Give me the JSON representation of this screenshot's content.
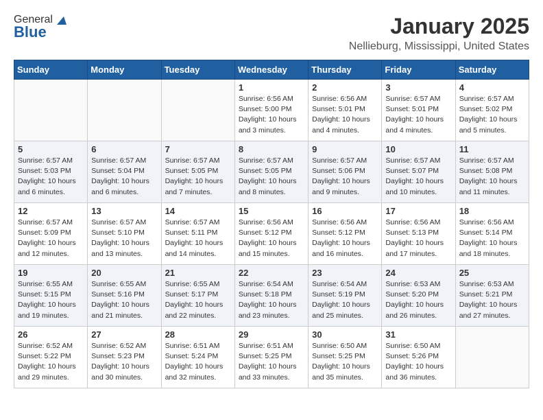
{
  "header": {
    "logo_general": "General",
    "logo_blue": "Blue",
    "title": "January 2025",
    "subtitle": "Nellieburg, Mississippi, United States"
  },
  "weekdays": [
    "Sunday",
    "Monday",
    "Tuesday",
    "Wednesday",
    "Thursday",
    "Friday",
    "Saturday"
  ],
  "weeks": [
    [
      {
        "day": "",
        "sunrise": "",
        "sunset": "",
        "daylight": ""
      },
      {
        "day": "",
        "sunrise": "",
        "sunset": "",
        "daylight": ""
      },
      {
        "day": "",
        "sunrise": "",
        "sunset": "",
        "daylight": ""
      },
      {
        "day": "1",
        "sunrise": "Sunrise: 6:56 AM",
        "sunset": "Sunset: 5:00 PM",
        "daylight": "Daylight: 10 hours and 3 minutes."
      },
      {
        "day": "2",
        "sunrise": "Sunrise: 6:56 AM",
        "sunset": "Sunset: 5:01 PM",
        "daylight": "Daylight: 10 hours and 4 minutes."
      },
      {
        "day": "3",
        "sunrise": "Sunrise: 6:57 AM",
        "sunset": "Sunset: 5:01 PM",
        "daylight": "Daylight: 10 hours and 4 minutes."
      },
      {
        "day": "4",
        "sunrise": "Sunrise: 6:57 AM",
        "sunset": "Sunset: 5:02 PM",
        "daylight": "Daylight: 10 hours and 5 minutes."
      }
    ],
    [
      {
        "day": "5",
        "sunrise": "Sunrise: 6:57 AM",
        "sunset": "Sunset: 5:03 PM",
        "daylight": "Daylight: 10 hours and 6 minutes."
      },
      {
        "day": "6",
        "sunrise": "Sunrise: 6:57 AM",
        "sunset": "Sunset: 5:04 PM",
        "daylight": "Daylight: 10 hours and 6 minutes."
      },
      {
        "day": "7",
        "sunrise": "Sunrise: 6:57 AM",
        "sunset": "Sunset: 5:05 PM",
        "daylight": "Daylight: 10 hours and 7 minutes."
      },
      {
        "day": "8",
        "sunrise": "Sunrise: 6:57 AM",
        "sunset": "Sunset: 5:05 PM",
        "daylight": "Daylight: 10 hours and 8 minutes."
      },
      {
        "day": "9",
        "sunrise": "Sunrise: 6:57 AM",
        "sunset": "Sunset: 5:06 PM",
        "daylight": "Daylight: 10 hours and 9 minutes."
      },
      {
        "day": "10",
        "sunrise": "Sunrise: 6:57 AM",
        "sunset": "Sunset: 5:07 PM",
        "daylight": "Daylight: 10 hours and 10 minutes."
      },
      {
        "day": "11",
        "sunrise": "Sunrise: 6:57 AM",
        "sunset": "Sunset: 5:08 PM",
        "daylight": "Daylight: 10 hours and 11 minutes."
      }
    ],
    [
      {
        "day": "12",
        "sunrise": "Sunrise: 6:57 AM",
        "sunset": "Sunset: 5:09 PM",
        "daylight": "Daylight: 10 hours and 12 minutes."
      },
      {
        "day": "13",
        "sunrise": "Sunrise: 6:57 AM",
        "sunset": "Sunset: 5:10 PM",
        "daylight": "Daylight: 10 hours and 13 minutes."
      },
      {
        "day": "14",
        "sunrise": "Sunrise: 6:57 AM",
        "sunset": "Sunset: 5:11 PM",
        "daylight": "Daylight: 10 hours and 14 minutes."
      },
      {
        "day": "15",
        "sunrise": "Sunrise: 6:56 AM",
        "sunset": "Sunset: 5:12 PM",
        "daylight": "Daylight: 10 hours and 15 minutes."
      },
      {
        "day": "16",
        "sunrise": "Sunrise: 6:56 AM",
        "sunset": "Sunset: 5:12 PM",
        "daylight": "Daylight: 10 hours and 16 minutes."
      },
      {
        "day": "17",
        "sunrise": "Sunrise: 6:56 AM",
        "sunset": "Sunset: 5:13 PM",
        "daylight": "Daylight: 10 hours and 17 minutes."
      },
      {
        "day": "18",
        "sunrise": "Sunrise: 6:56 AM",
        "sunset": "Sunset: 5:14 PM",
        "daylight": "Daylight: 10 hours and 18 minutes."
      }
    ],
    [
      {
        "day": "19",
        "sunrise": "Sunrise: 6:55 AM",
        "sunset": "Sunset: 5:15 PM",
        "daylight": "Daylight: 10 hours and 19 minutes."
      },
      {
        "day": "20",
        "sunrise": "Sunrise: 6:55 AM",
        "sunset": "Sunset: 5:16 PM",
        "daylight": "Daylight: 10 hours and 21 minutes."
      },
      {
        "day": "21",
        "sunrise": "Sunrise: 6:55 AM",
        "sunset": "Sunset: 5:17 PM",
        "daylight": "Daylight: 10 hours and 22 minutes."
      },
      {
        "day": "22",
        "sunrise": "Sunrise: 6:54 AM",
        "sunset": "Sunset: 5:18 PM",
        "daylight": "Daylight: 10 hours and 23 minutes."
      },
      {
        "day": "23",
        "sunrise": "Sunrise: 6:54 AM",
        "sunset": "Sunset: 5:19 PM",
        "daylight": "Daylight: 10 hours and 25 minutes."
      },
      {
        "day": "24",
        "sunrise": "Sunrise: 6:53 AM",
        "sunset": "Sunset: 5:20 PM",
        "daylight": "Daylight: 10 hours and 26 minutes."
      },
      {
        "day": "25",
        "sunrise": "Sunrise: 6:53 AM",
        "sunset": "Sunset: 5:21 PM",
        "daylight": "Daylight: 10 hours and 27 minutes."
      }
    ],
    [
      {
        "day": "26",
        "sunrise": "Sunrise: 6:52 AM",
        "sunset": "Sunset: 5:22 PM",
        "daylight": "Daylight: 10 hours and 29 minutes."
      },
      {
        "day": "27",
        "sunrise": "Sunrise: 6:52 AM",
        "sunset": "Sunset: 5:23 PM",
        "daylight": "Daylight: 10 hours and 30 minutes."
      },
      {
        "day": "28",
        "sunrise": "Sunrise: 6:51 AM",
        "sunset": "Sunset: 5:24 PM",
        "daylight": "Daylight: 10 hours and 32 minutes."
      },
      {
        "day": "29",
        "sunrise": "Sunrise: 6:51 AM",
        "sunset": "Sunset: 5:25 PM",
        "daylight": "Daylight: 10 hours and 33 minutes."
      },
      {
        "day": "30",
        "sunrise": "Sunrise: 6:50 AM",
        "sunset": "Sunset: 5:25 PM",
        "daylight": "Daylight: 10 hours and 35 minutes."
      },
      {
        "day": "31",
        "sunrise": "Sunrise: 6:50 AM",
        "sunset": "Sunset: 5:26 PM",
        "daylight": "Daylight: 10 hours and 36 minutes."
      },
      {
        "day": "",
        "sunrise": "",
        "sunset": "",
        "daylight": ""
      }
    ]
  ]
}
